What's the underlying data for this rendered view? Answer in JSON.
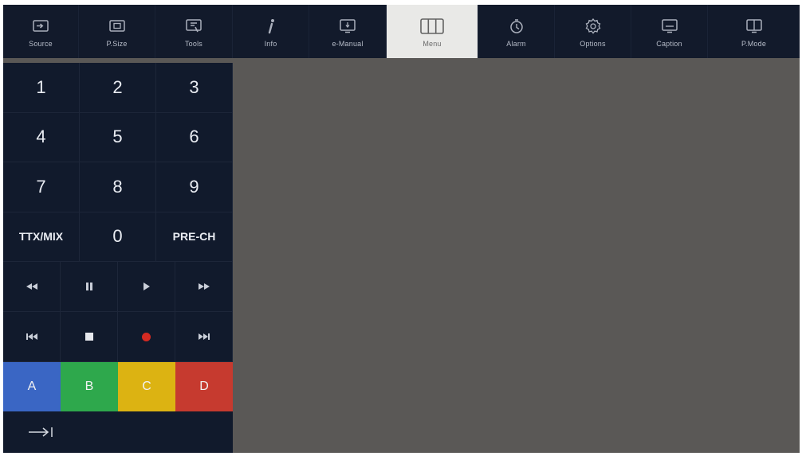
{
  "topbar": {
    "items": [
      {
        "label": "Source",
        "icon": "source-icon"
      },
      {
        "label": "P.Size",
        "icon": "picture-size-icon"
      },
      {
        "label": "Tools",
        "icon": "tools-icon"
      },
      {
        "label": "Info",
        "icon": "info-icon"
      },
      {
        "label": "e-Manual",
        "icon": "e-manual-icon"
      },
      {
        "label": "Menu",
        "icon": "menu-icon",
        "active": true
      },
      {
        "label": "Alarm",
        "icon": "alarm-icon"
      },
      {
        "label": "Options",
        "icon": "options-icon"
      },
      {
        "label": "Caption",
        "icon": "caption-icon"
      },
      {
        "label": "P.Mode",
        "icon": "picture-mode-icon"
      }
    ]
  },
  "keypad": {
    "k1": "1",
    "k2": "2",
    "k3": "3",
    "k4": "4",
    "k5": "5",
    "k6": "6",
    "k7": "7",
    "k8": "8",
    "k9": "9",
    "ttx": "TTX/MIX",
    "k0": "0",
    "prech": "PRE-CH"
  },
  "media": {
    "row1": [
      "rewind-icon",
      "pause-icon",
      "play-icon",
      "fast-forward-icon"
    ],
    "row2": [
      "skip-previous-icon",
      "stop-icon",
      "record-icon",
      "skip-next-icon"
    ]
  },
  "color_keys": {
    "a": {
      "label": "A",
      "color": "#3a66c4"
    },
    "b": {
      "label": "B",
      "color": "#2ea84c"
    },
    "c": {
      "label": "C",
      "color": "#dcb312"
    },
    "d": {
      "label": "D",
      "color": "#c63a2f"
    }
  },
  "colors": {
    "bar_bg": "#121a2b",
    "panel_bg": "#111a2c",
    "active_bg": "#e9e9e7",
    "screen_bg": "#5a5856",
    "record": "#d42a22"
  },
  "exit": {
    "icon": "exit-icon"
  }
}
